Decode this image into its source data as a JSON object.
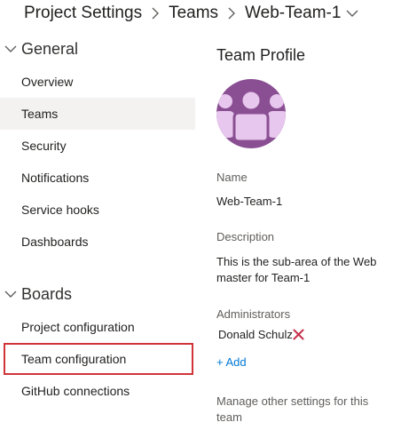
{
  "breadcrumb": {
    "items": [
      "Project Settings",
      "Teams",
      "Web-Team-1"
    ]
  },
  "sidebar": {
    "groups": [
      {
        "title": "General",
        "items": [
          "Overview",
          "Teams",
          "Security",
          "Notifications",
          "Service hooks",
          "Dashboards"
        ]
      },
      {
        "title": "Boards",
        "items": [
          "Project configuration",
          "Team configuration",
          "GitHub connections"
        ]
      }
    ],
    "selected": "Teams",
    "highlighted": "Team configuration"
  },
  "profile": {
    "title": "Team Profile",
    "name_label": "Name",
    "name_value": "Web-Team-1",
    "description_label": "Description",
    "description_value": "This is the sub-area of the Web master for Team-1",
    "admins_label": "Administrators",
    "admins": [
      "Donald Schulz"
    ],
    "add_label": "+ Add",
    "manage_text": "Manage other settings for this team"
  },
  "colors": {
    "accent": "#0078d4",
    "avatar_bg": "#8a4f93",
    "avatar_figure": "#e8c7ee",
    "remove": "#c4314b",
    "highlight_border": "#d13438",
    "selected_bg": "#f3f2f1"
  }
}
